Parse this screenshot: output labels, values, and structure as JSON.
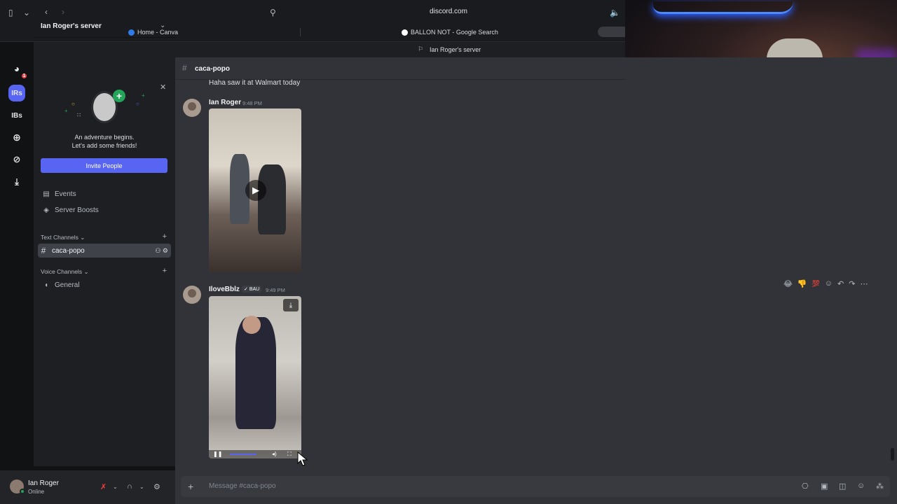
{
  "browser": {
    "url": "discord.com",
    "tabs": [
      {
        "label": "Home - Canva"
      },
      {
        "label": "BALLON NOT - Google Search"
      }
    ],
    "window_title": "Ian Roger's server"
  },
  "server_rail": {
    "items": [
      {
        "label": "",
        "name": "discord-home",
        "badge": "1"
      },
      {
        "label": "IRs",
        "name": "server-irs"
      },
      {
        "label": "IBs",
        "name": "server-ibs"
      }
    ]
  },
  "sidebar": {
    "server_name": "Ian Roger's server",
    "invite": {
      "line1": "An adventure begins.",
      "line2": "Let's add some friends!",
      "button": "Invite People"
    },
    "items": [
      {
        "label": "Events",
        "icon": "calendar-icon"
      },
      {
        "label": "Server Boosts",
        "icon": "boost-icon"
      }
    ],
    "text_category": "Text Channels",
    "voice_category": "Voice Channels",
    "text_channels": [
      {
        "label": "caca-popo"
      }
    ],
    "voice_channels": [
      {
        "label": "General"
      }
    ]
  },
  "user": {
    "name": "Ian Roger",
    "status": "Online"
  },
  "channel": {
    "name": "caca-popo"
  },
  "messages": [
    {
      "text": "Haha saw it at Walmart today"
    },
    {
      "author": "Ian Roger",
      "time": "9:48 PM"
    },
    {
      "author": "IloveBblz",
      "tag": "BAU",
      "time": "9:49 PM"
    }
  ],
  "composer": {
    "placeholder": "Message #caca-popo"
  },
  "colors": {
    "accent": "#5865f2",
    "online": "#23a55a",
    "background": "#313338",
    "sidebar": "#1e1f22"
  }
}
